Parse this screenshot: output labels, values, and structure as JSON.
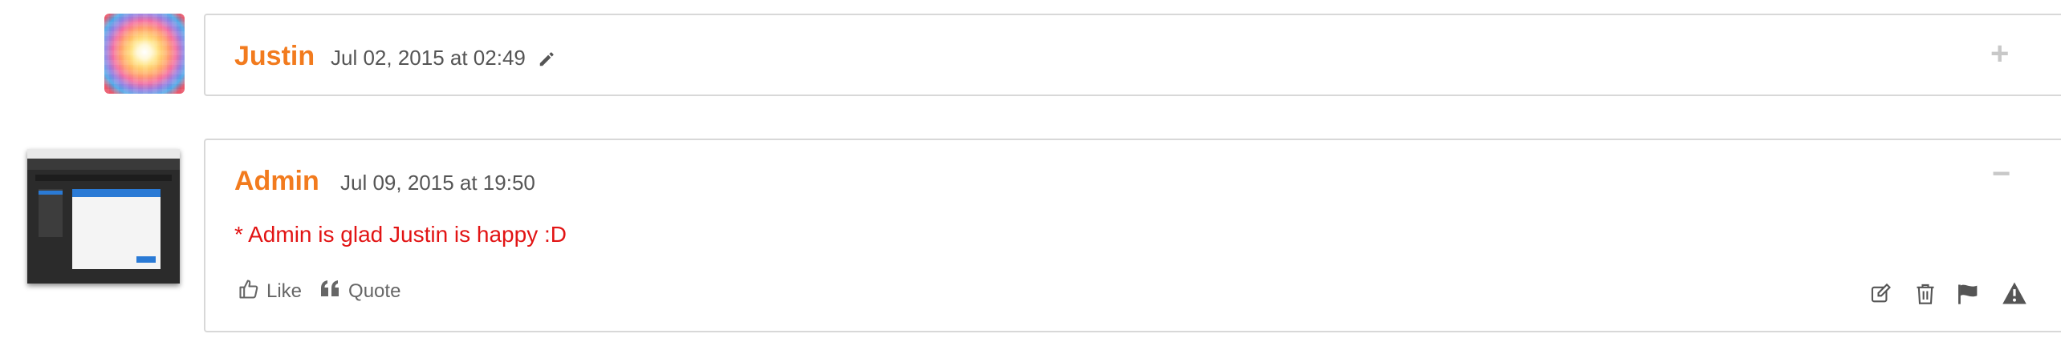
{
  "comments": [
    {
      "author": "Justin",
      "date": "Jul 02, 2015 at 02:49",
      "collapsed_toggle": "+",
      "avatar_icon": "color-squares-avatar",
      "edit_icon": "pencil-icon"
    },
    {
      "author": "Admin",
      "date": "Jul 09, 2015 at 19:50",
      "collapsed_toggle": "−",
      "avatar_icon": "screenshot-thumbnail-avatar",
      "message": "* Admin is glad Justin is happy :D",
      "actions": {
        "like_label": "Like",
        "quote_label": "Quote"
      },
      "tools": [
        "edit-icon",
        "trash-icon",
        "flag-icon",
        "warning-icon"
      ]
    }
  ],
  "colors": {
    "author": "#f27b1e",
    "message": "#e21414",
    "border": "#d8d8d8",
    "muted": "#555555"
  }
}
